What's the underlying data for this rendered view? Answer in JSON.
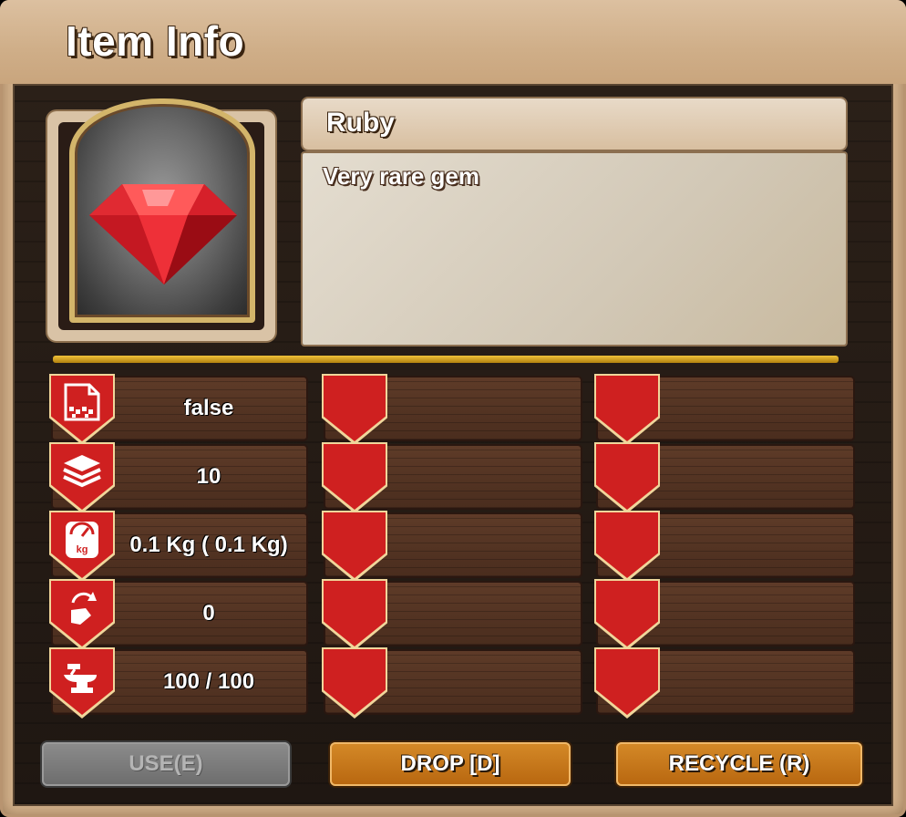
{
  "window": {
    "title": "Item Info"
  },
  "item": {
    "name": "Ruby",
    "description": "Very rare gem",
    "image_icon": "ruby-gem-icon"
  },
  "stats": [
    {
      "icon": "sellable-icon",
      "value": "false"
    },
    {
      "icon": "stack-layers-icon",
      "value": "10"
    },
    {
      "icon": "weight-scale-icon",
      "value": "0.1 Kg ( 0.1 Kg)"
    },
    {
      "icon": "repair-hand-icon",
      "value": "0"
    },
    {
      "icon": "anvil-durability-icon",
      "value": "100 / 100"
    }
  ],
  "buttons": {
    "use": "USE(E)",
    "drop": "DROP [D]",
    "recycle": "RECYCLE (R)"
  },
  "colors": {
    "ribbon": "#cf2020",
    "gold_divider": "#d4a020",
    "button_orange": "#c8781c",
    "button_disabled": "#7c7c7c"
  }
}
